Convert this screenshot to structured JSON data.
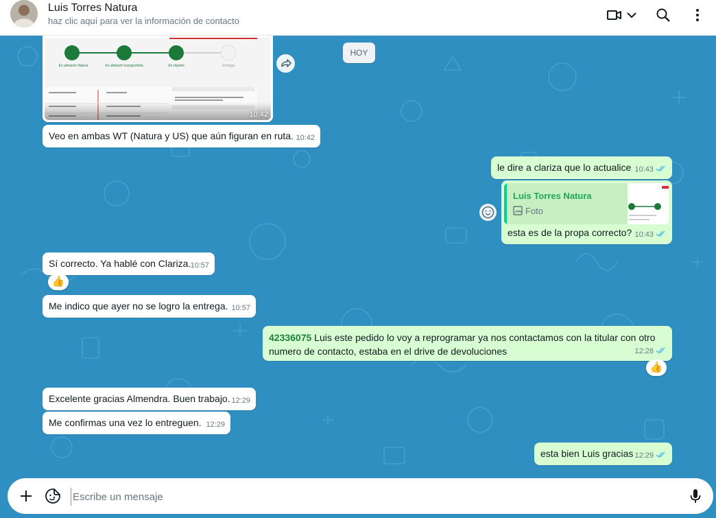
{
  "header": {
    "contact_name": "Luis Torres Natura",
    "contact_sub": "haz clic aquí para ver la información de contacto"
  },
  "chat": {
    "date_chip": "HOY",
    "image_message": {
      "time": "10:42",
      "steps": [
        "En almacén Natura",
        "En almacén transportista",
        "En reparto",
        "Entrega"
      ]
    },
    "messages": [
      {
        "text": "Veo en ambas WT (Natura y US) que aún figuran en ruta.",
        "time": "10:42"
      },
      {
        "text": "le dire a clariza que lo actualice",
        "time": "10:43"
      },
      {
        "quote_name": "Luis Torres Natura",
        "quote_type": "Foto",
        "text": "esta es de la propa correcto?",
        "time": "10:43"
      },
      {
        "text": "Sí correcto. Ya hablé con Clariza.",
        "time": "10:57",
        "reaction": "👍"
      },
      {
        "text": "Me indico que ayer no se logro la entrega.",
        "time": "10:57"
      },
      {
        "number": "42336075",
        "text": " Luis este pedido lo voy a reprogramar ya nos contactamos con la titular con otro numero de contacto, estaba en el drive de devoluciones",
        "time": "12:28",
        "reaction": "👍"
      },
      {
        "text": "Excelente gracias Almendra. Buen trabajo.",
        "time": "12:29"
      },
      {
        "text": "Me confirmas una vez lo entreguen.",
        "time": "12:29"
      },
      {
        "text": "esta bien Luis gracias",
        "time": "12:29"
      }
    ]
  },
  "composer": {
    "placeholder": "Escribe un mensaje"
  },
  "colors": {
    "chat_background": "#2f8fc0",
    "outgoing_bubble": "#d9fdd3",
    "incoming_bubble": "#ffffff",
    "read_ticks": "#53bdeb",
    "brand_green": "#1fa855"
  },
  "icons": {
    "video": "video-call-icon",
    "dropdown": "chevron-down-icon",
    "search": "search-icon",
    "menu": "menu-dots-icon",
    "forward": "forward-icon",
    "emoji_reaction": "emoji-icon",
    "attach": "plus-icon",
    "sticker": "sticker-icon",
    "mic": "microphone-icon"
  }
}
